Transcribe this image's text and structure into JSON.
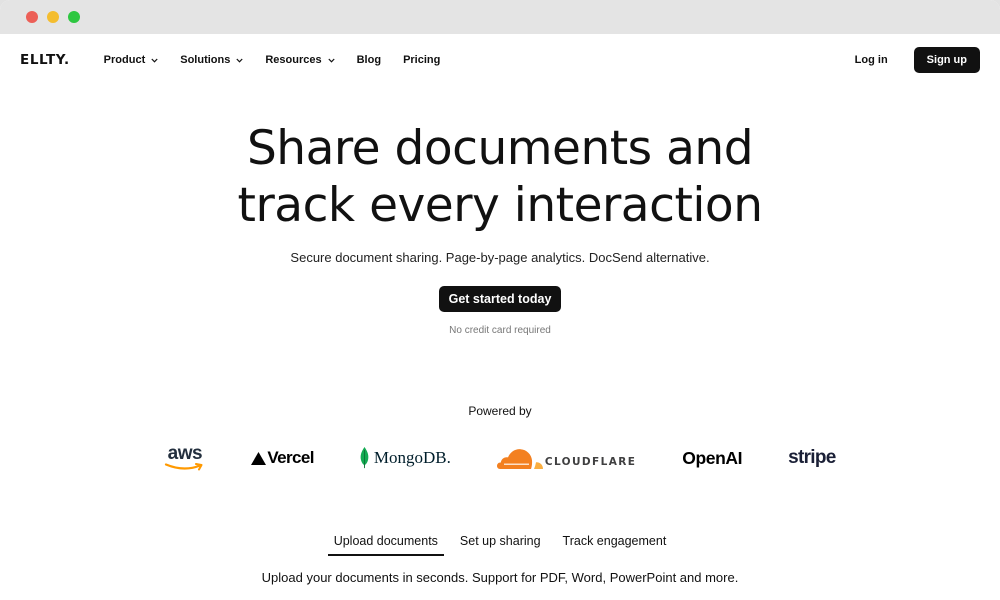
{
  "window": {
    "dots": [
      "#ec5f57",
      "#f4bd2f",
      "#2ec741"
    ]
  },
  "nav": {
    "logo": "ELLTY.",
    "items": [
      {
        "label": "Product",
        "dropdown": true
      },
      {
        "label": "Solutions",
        "dropdown": true
      },
      {
        "label": "Resources",
        "dropdown": true
      },
      {
        "label": "Blog",
        "dropdown": false
      },
      {
        "label": "Pricing",
        "dropdown": false
      }
    ],
    "login": "Log in",
    "signup": "Sign up"
  },
  "hero": {
    "headline_line1": "Share documents and",
    "headline_line2": "track every interaction",
    "subtitle": "Secure document sharing. Page-by-page analytics. DocSend alternative.",
    "cta": "Get started today",
    "note": "No credit card required"
  },
  "powered": {
    "label": "Powered by",
    "logos": [
      {
        "name": "aws",
        "text": "aws",
        "icon": "aws-smile-icon",
        "color": "#232f3e",
        "accent": "#ff9900"
      },
      {
        "name": "vercel",
        "text": "Vercel",
        "icon": "vercel-triangle-icon",
        "color": "#000000"
      },
      {
        "name": "mongodb",
        "text": "MongoDB.",
        "icon": "mongodb-leaf-icon",
        "color": "#001e2b"
      },
      {
        "name": "cloudflare",
        "text": "CLOUDFLARE",
        "icon": "cloudflare-cloud-icon",
        "color": "#404041",
        "accent": "#f38020"
      },
      {
        "name": "openai",
        "text": "OpenAI",
        "color": "#000000"
      },
      {
        "name": "stripe",
        "text": "stripe",
        "color": "#1a1f36"
      }
    ]
  },
  "tabs": {
    "items": [
      "Upload documents",
      "Set up sharing",
      "Track engagement"
    ],
    "active_index": 0,
    "description": "Upload your documents in seconds. Support for PDF, Word, PowerPoint and more."
  }
}
